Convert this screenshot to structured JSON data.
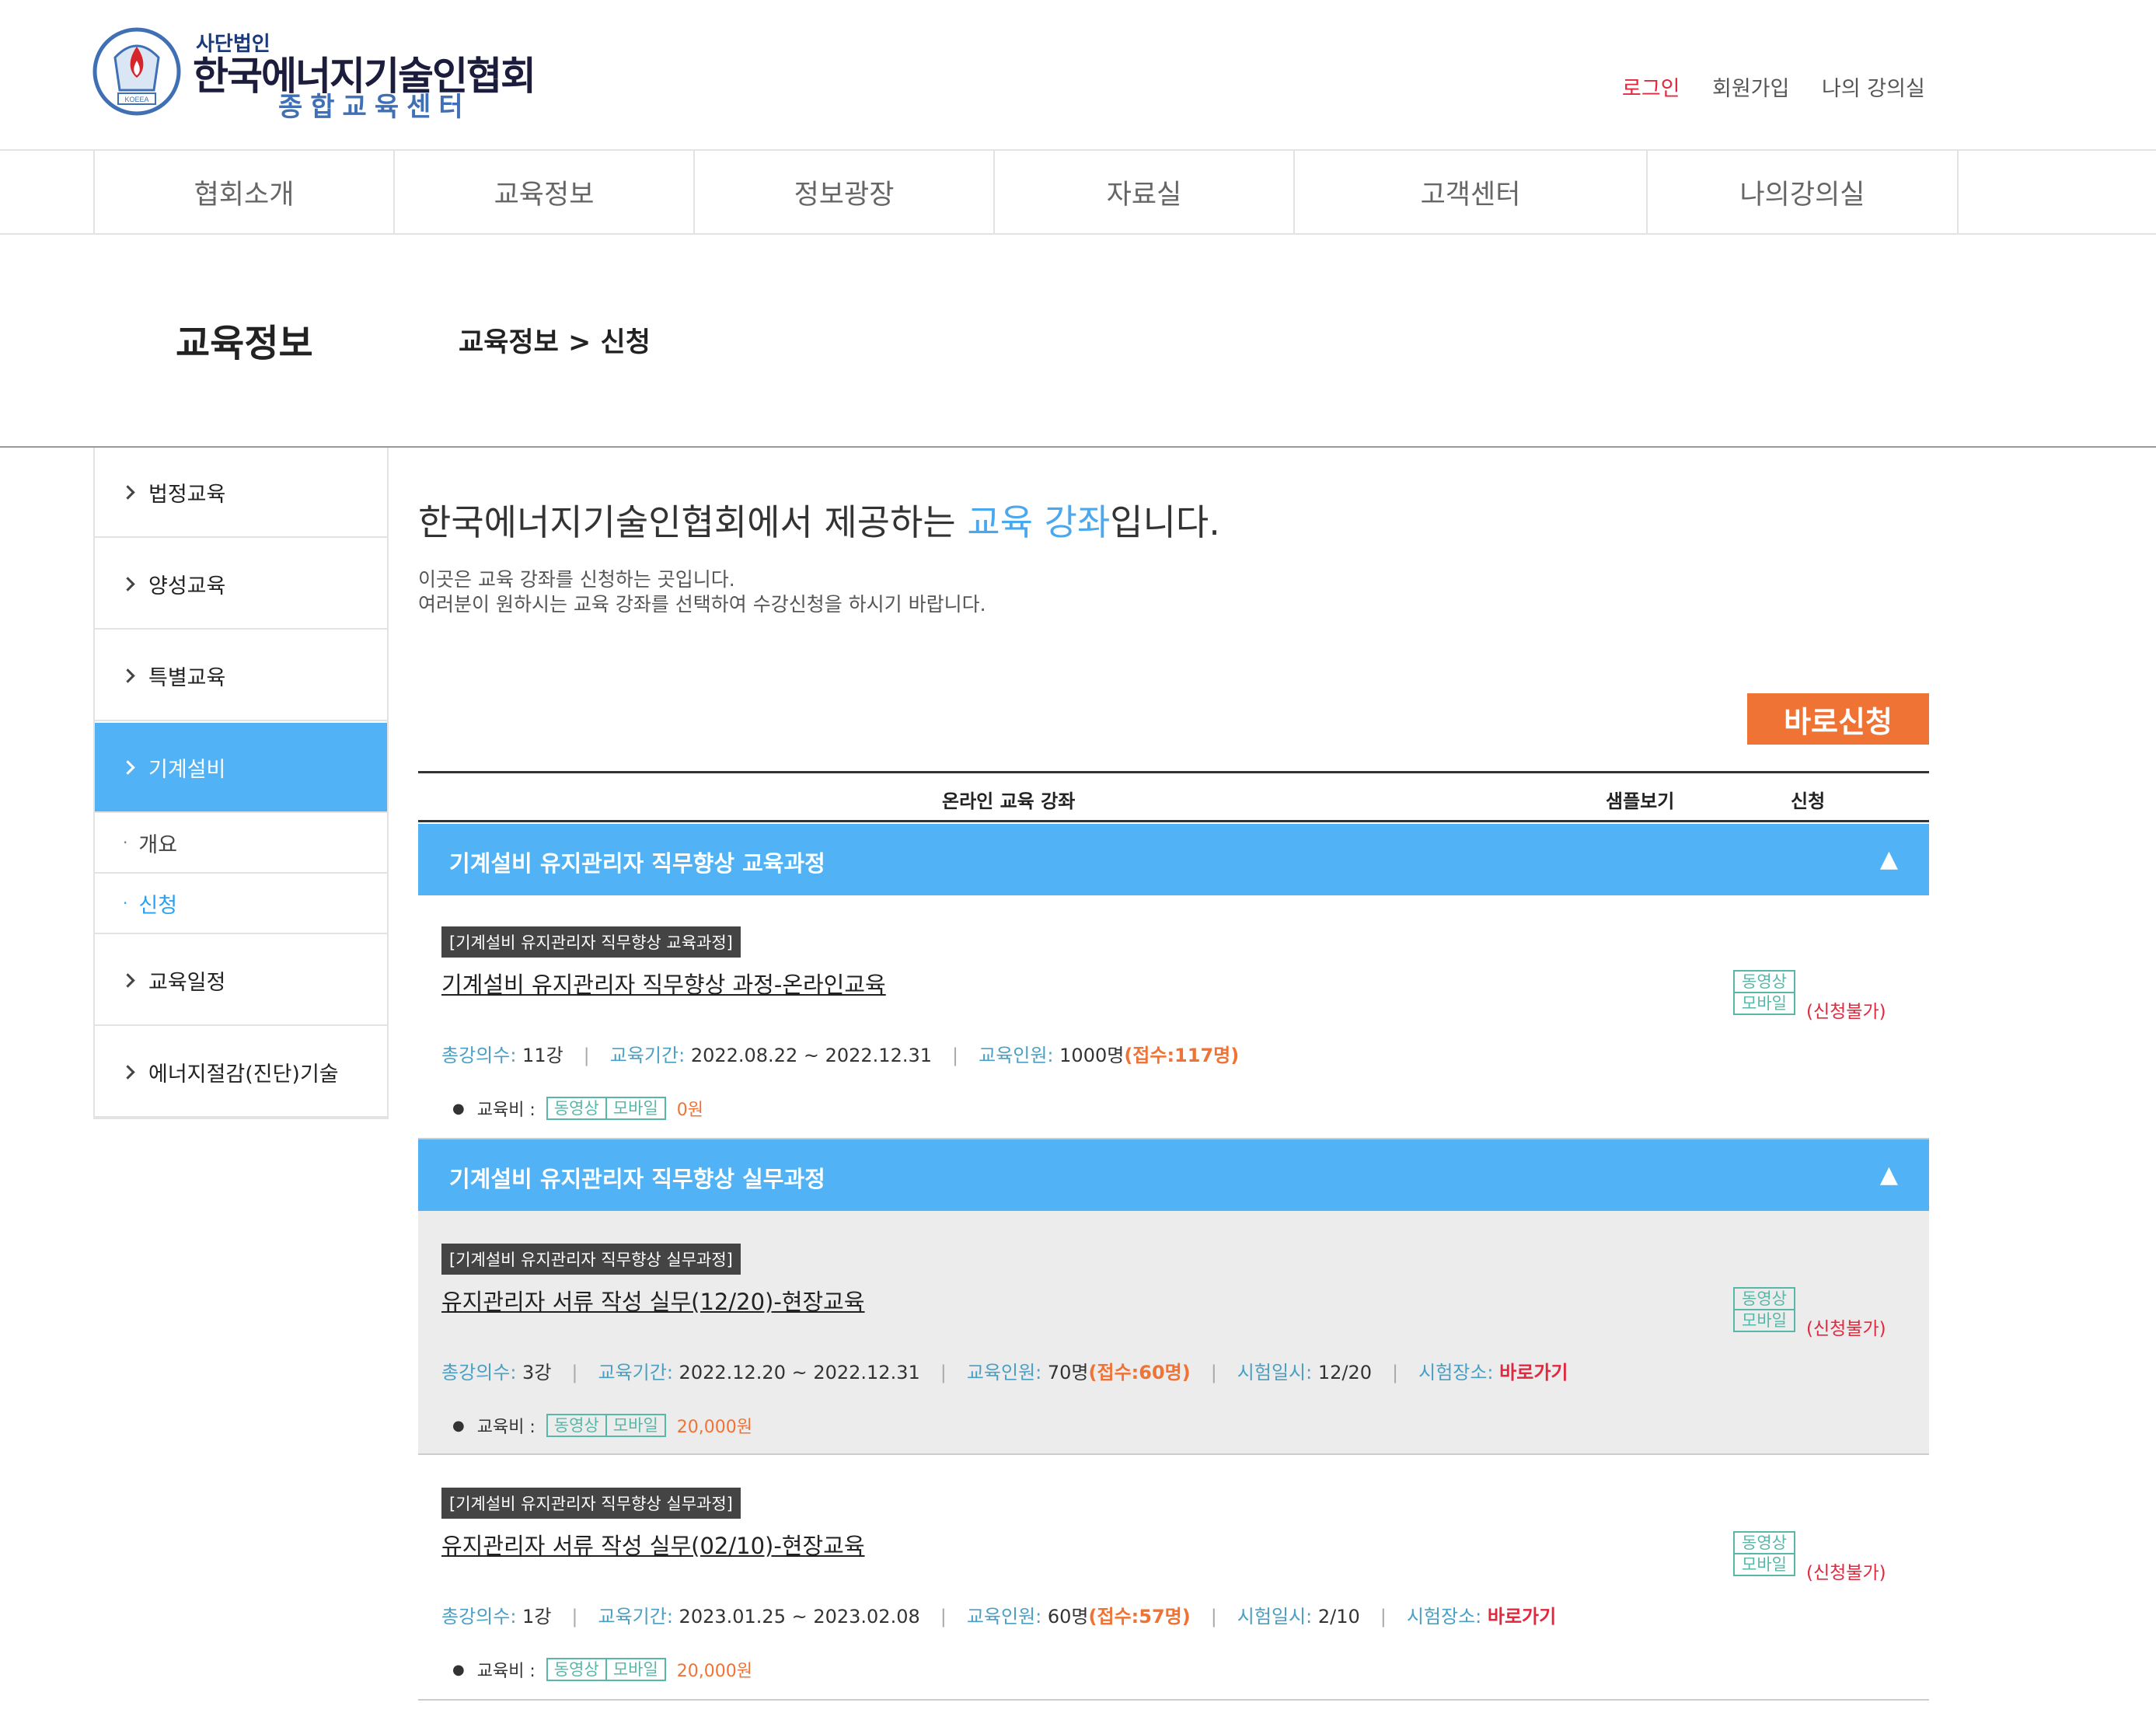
{
  "brand": {
    "sub": "사단법인",
    "name": "한국에너지기술인협회",
    "center": "종합교육센터",
    "emblem_text": "KOEEA",
    "colors": {
      "navy": "#1c3a7a",
      "flame": "#d6252b",
      "blue": "#3f6fb5"
    }
  },
  "top_links": {
    "login": "로그인",
    "signup": "회원가입",
    "my_classroom": "나의 강의실"
  },
  "nav": [
    "협회소개",
    "교육정보",
    "정보광장",
    "자료실",
    "고객센터",
    "나의강의실"
  ],
  "page": {
    "section_title": "교육정보",
    "breadcrumb": "교육정보 > 신청"
  },
  "sidebar": {
    "items": [
      "법정교육",
      "양성교육",
      "특별교육",
      "기계설비",
      "교육일정",
      "에너지절감(진단)기술"
    ],
    "active": "기계설비",
    "sub_items": [
      "개요",
      "신청"
    ],
    "active_sub": "신청"
  },
  "main": {
    "headline_pre": "한국에너지기술인협회에서 제공하는 ",
    "headline_highlight": "교육 강좌",
    "headline_post": "입니다.",
    "desc1": "이곳은 교육 강좌를 신청하는 곳입니다.",
    "desc2": "여러분이 원하시는 교육 강좌를 선택하여 수강신청을 하시기 바랍니다.",
    "apply_button": "바로신청",
    "table_head": {
      "course": "온라인 교육 강좌",
      "sample": "샘플보기",
      "apply": "신청"
    },
    "labels": {
      "lectures": "총강의수:",
      "period": "교육기간:",
      "capacity": "교육인원:",
      "exam_date": "시험일시:",
      "exam_place": "시험장소:",
      "fee": "교육비 :",
      "video": "동영상",
      "mobile": "모바일",
      "unavailable": "(신청불가)",
      "go": "바로가기"
    },
    "groups": [
      {
        "title": "기계설비 유지관리자 직무향상 교육과정",
        "toggle": "▲",
        "courses": [
          {
            "tag": "[기계설비 유지관리자 직무향상 교육과정]",
            "title": "기계설비 유지관리자 직무향상 과정-온라인교육",
            "lectures": "11강",
            "period": "2022.08.22 ~ 2022.12.31",
            "capacity": "1000명",
            "received": "(접수:117명)",
            "price": "0원"
          }
        ]
      },
      {
        "title": "기계설비 유지관리자 직무향상 실무과정",
        "toggle": "▲",
        "courses": [
          {
            "tag": "[기계설비 유지관리자 직무향상 실무과정]",
            "title": "유지관리자 서류 작성 실무(12/20)-현장교육",
            "lectures": "3강",
            "period": "2022.12.20 ~ 2022.12.31",
            "capacity": "70명",
            "received": "(접수:60명)",
            "exam_date": "12/20",
            "price": "20,000원"
          },
          {
            "tag": "[기계설비 유지관리자 직무향상 실무과정]",
            "title": "유지관리자 서류 작성 실무(02/10)-현장교육",
            "lectures": "1강",
            "period": "2023.01.25 ~ 2023.02.08",
            "capacity": "60명",
            "received": "(접수:57명)",
            "exam_date": "2/10",
            "price": "20,000원"
          }
        ]
      }
    ]
  }
}
